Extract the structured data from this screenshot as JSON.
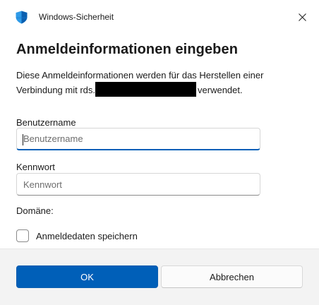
{
  "window": {
    "app_title": "Windows-Sicherheit",
    "app_icon": "shield-icon",
    "close_icon": "close-icon"
  },
  "dialog": {
    "heading": "Anmeldeinformationen eingeben",
    "description_part1": "Diese Anmeldeinformationen werden für das Herstellen einer Verbindung mit rds.",
    "description_part2": "verwendet."
  },
  "form": {
    "username_label": "Benutzername",
    "username_placeholder": "Benutzername",
    "username_value": "",
    "password_label": "Kennwort",
    "password_placeholder": "Kennwort",
    "password_value": "",
    "domain_label": "Domäne:",
    "remember_label": "Anmeldedaten speichern",
    "remember_checked": false
  },
  "footer": {
    "ok_label": "OK",
    "cancel_label": "Abbrechen"
  },
  "colors": {
    "accent": "#005fb8",
    "shield_light": "#2f9be8",
    "shield_dark": "#0a5fb0",
    "footer_bg": "#f3f3f3"
  }
}
